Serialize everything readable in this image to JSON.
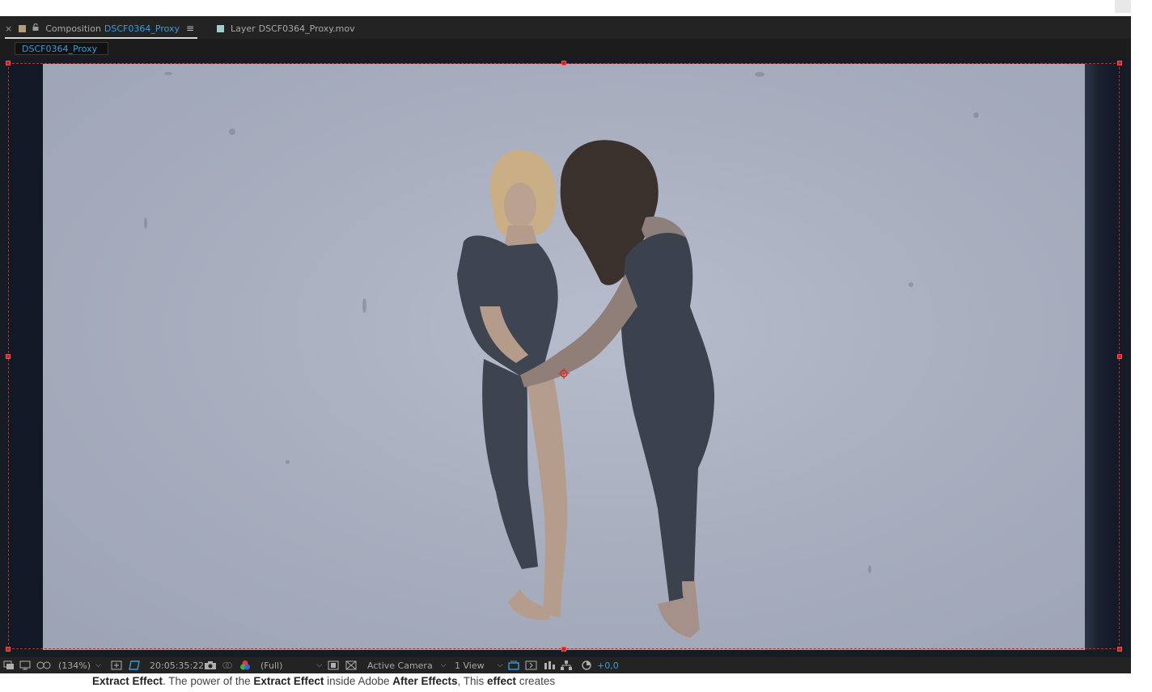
{
  "tabs": {
    "composition": {
      "prefix": "Composition",
      "name": "DSCF0364_Proxy",
      "swatch_color": "#b79b7a"
    },
    "layer": {
      "prefix": "Layer",
      "name": "DSCF0364_Proxy.mov",
      "swatch_color": "#9ed0c8"
    }
  },
  "breadcrumb": {
    "label": "DSCF0364_Proxy"
  },
  "toolbar": {
    "zoom": "(134%)",
    "timecode": "20:05:35:22",
    "resolution": "(Full)",
    "camera": "Active Camera",
    "views": "1 View",
    "exposure": "+0,0"
  },
  "caption": {
    "part1": "Extract Effect",
    "part2": ". The power of the ",
    "part3": "Extract Effect",
    "part4": " inside Adobe ",
    "part5": "After Effects",
    "part6": ", This ",
    "part7": "effect",
    "part8": " creates"
  },
  "colors": {
    "accent": "#3b9bdc",
    "panel_bg": "#1c1c1c",
    "handle": "#cc2222"
  }
}
